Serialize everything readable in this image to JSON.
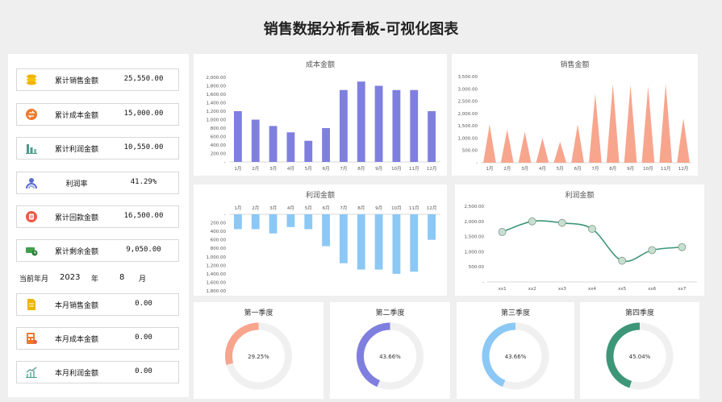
{
  "header": {
    "title": "销售数据分析看板-可视化图表"
  },
  "kpis": [
    {
      "label": "累计销售金额",
      "value": "25,550.00",
      "icon": "coins-icon",
      "color": "#f0b400"
    },
    {
      "label": "累计成本金额",
      "value": "15,000.00",
      "icon": "exchange-icon",
      "color": "#f07a2a"
    },
    {
      "label": "累计利润金额",
      "value": "10,550.00",
      "icon": "profit-bars-icon",
      "color": "#4a9a88"
    },
    {
      "label": "利润率",
      "value": "41.29%",
      "icon": "user-rate-icon",
      "color": "#5b6ad0"
    },
    {
      "label": "累计回款金额",
      "value": "16,500.00",
      "icon": "payment-icon",
      "color": "#ea5b47"
    },
    {
      "label": "累计剩余金额",
      "value": "9,050.00",
      "icon": "money-clock-icon",
      "color": "#3fa04a"
    }
  ],
  "date_row": {
    "label": "当前年月",
    "year": "2023",
    "year_unit": "年",
    "month": "8",
    "month_unit": "月"
  },
  "monthly": [
    {
      "label": "本月销售金额",
      "value": "0.00",
      "icon": "document-icon",
      "color": "#f0b400"
    },
    {
      "label": "本月成本金额",
      "value": "0.00",
      "icon": "calculator-icon",
      "color": "#f07a2a"
    },
    {
      "label": "本月利润金额",
      "value": "0.00",
      "icon": "growth-chart-icon",
      "color": "#4a9a88"
    }
  ],
  "chart_data": [
    {
      "type": "bar",
      "title": "成本金额",
      "categories": [
        "1月",
        "2月",
        "3月",
        "4月",
        "5月",
        "6月",
        "7月",
        "8月",
        "9月",
        "10月",
        "11月",
        "12月"
      ],
      "values": [
        1200,
        1000,
        850,
        700,
        500,
        800,
        1700,
        1900,
        1800,
        1700,
        1700,
        1200
      ],
      "ylim": [
        0,
        2000
      ],
      "yticks": [
        "-",
        "200.00",
        "400.00",
        "600.00",
        "800.00",
        "1,000.00",
        "1,200.00",
        "1,400.00",
        "1,600.00",
        "1,800.00",
        "2,000.00"
      ],
      "color": "#7f7fe0"
    },
    {
      "type": "area",
      "title": "销售金额",
      "categories": [
        "1月",
        "2月",
        "3月",
        "4月",
        "5月",
        "6月",
        "7月",
        "8月",
        "9月",
        "10月",
        "11月",
        "12月"
      ],
      "values": [
        1550,
        1350,
        1250,
        1000,
        850,
        1550,
        2800,
        3200,
        3150,
        3100,
        3200,
        1800
      ],
      "ylim": [
        0,
        3500
      ],
      "yticks": [
        "-",
        "500.00",
        "1,000.00",
        "1,500.00",
        "2,000.00",
        "2,500.00",
        "3,000.00",
        "3,500.00"
      ],
      "color": "#f8a58e"
    },
    {
      "type": "bar",
      "title": "利润金额",
      "categories": [
        "1月",
        "2月",
        "3月",
        "4月",
        "5月",
        "6月",
        "7月",
        "8月",
        "9月",
        "10月",
        "11月",
        "12月"
      ],
      "values": [
        -350,
        -350,
        -450,
        -300,
        -350,
        -750,
        -1150,
        -1300,
        -1300,
        -1400,
        -1350,
        -600
      ],
      "ylim": [
        -1800,
        0
      ],
      "yticks": [
        "-",
        "200.00",
        "400.00",
        "600.00",
        "800.00",
        "1,000.00",
        "1,200.00",
        "1,400.00",
        "1,600.00",
        "1,800.00"
      ],
      "color": "#8cc8f5"
    },
    {
      "type": "line",
      "title": "利润金额",
      "categories": [
        "xx1",
        "xx2",
        "xx3",
        "xx4",
        "xx5",
        "xx6",
        "xx7"
      ],
      "values": [
        1650,
        2000,
        1950,
        1750,
        700,
        1050,
        1150
      ],
      "ylim": [
        0,
        2500
      ],
      "yticks": [
        "-",
        "500.00",
        "1,000.00",
        "1,500.00",
        "2,000.00",
        "2,500.00"
      ],
      "color": "#3d9678"
    },
    {
      "type": "pie",
      "title": "第一季度",
      "value": 0.2925,
      "label": "29.25%",
      "color": "#f8a58e"
    },
    {
      "type": "pie",
      "title": "第二季度",
      "value": 0.4366,
      "label": "43.66%",
      "color": "#7f7fe0"
    },
    {
      "type": "pie",
      "title": "第三季度",
      "value": 0.4366,
      "label": "43.66%",
      "color": "#8cc8f5"
    },
    {
      "type": "pie",
      "title": "第四季度",
      "value": 0.4504,
      "label": "45.04%",
      "color": "#3d9678"
    }
  ]
}
